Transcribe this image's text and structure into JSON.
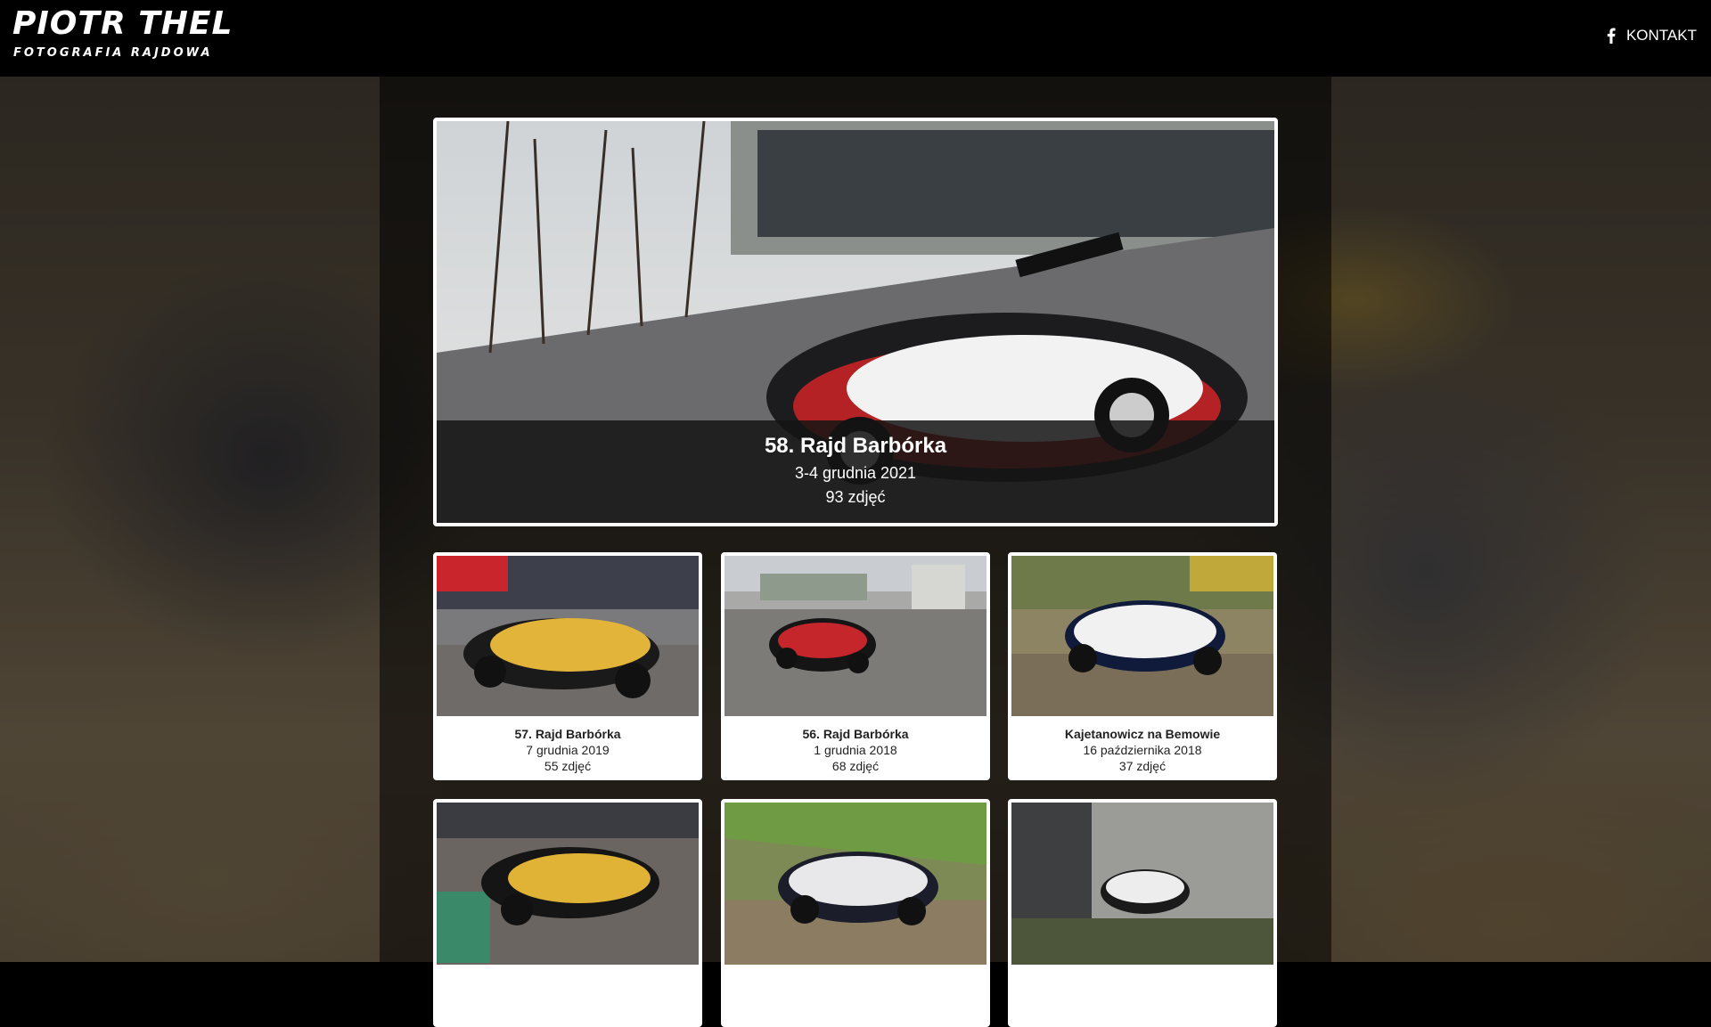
{
  "header": {
    "logo_title": "PIOTR THEL",
    "logo_subtitle": "FOTOGRAFIA RAJDOWA",
    "contact_label": "KONTAKT",
    "contact_icon": "facebook-icon"
  },
  "featured": {
    "title": "58. Rajd Barbórka",
    "date": "3-4 grudnia 2021",
    "count": "93 zdjęć"
  },
  "galleries": [
    {
      "title": "57. Rajd Barbórka",
      "date": "7 grudnia 2019",
      "count": "55 zdjęć"
    },
    {
      "title": "56. Rajd Barbórka",
      "date": "1 grudnia 2018",
      "count": "68 zdjęć"
    },
    {
      "title": "Kajetanowicz na Bemowie",
      "date": "16 października 2018",
      "count": "37 zdjęć"
    },
    {
      "title": "",
      "date": "",
      "count": ""
    },
    {
      "title": "",
      "date": "",
      "count": ""
    },
    {
      "title": "",
      "date": "",
      "count": ""
    }
  ],
  "colors": {
    "header_bg": "#000000",
    "card_border": "#ffffff",
    "caption_overlay": "#141414"
  }
}
